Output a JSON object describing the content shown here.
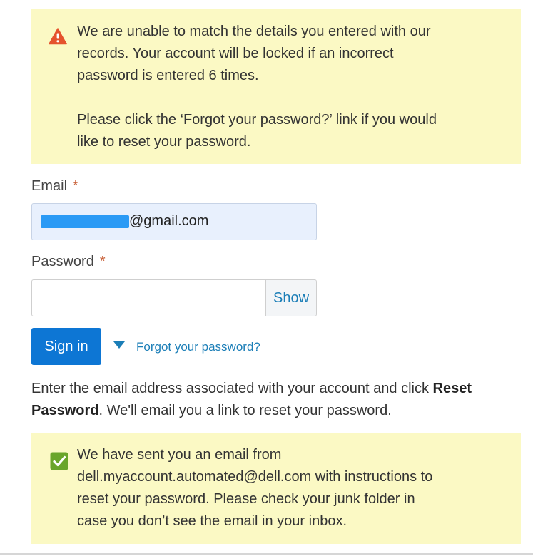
{
  "error_alert": {
    "icon": "warning-triangle-icon",
    "color": "#e5532d",
    "line1": "We are unable to match the details you entered with our",
    "line2": "records. Your account will be locked if an incorrect",
    "line3": "password is entered 6 times.",
    "line4": "Please click the ‘Forgot your password?’ link if you would",
    "line5": "like to reset your password."
  },
  "form": {
    "email_label": "Email",
    "required_marker": "*",
    "email_value_visible": "@gmail.com",
    "password_label": "Password",
    "password_value": "",
    "show_button": "Show",
    "signin_button": "Sign in",
    "forgot_link": "Forgot your password?"
  },
  "instructions": {
    "before": "Enter the email address associated with your account and click ",
    "bold": "Reset Password",
    "after": ". We'll email you a link to reset your password."
  },
  "success_alert": {
    "icon": "check-box-icon",
    "color": "#6aa52b",
    "line1": "We have sent you an email from",
    "line2": "dell.myaccount.automated@dell.com with instructions to",
    "line3": "reset your password. Please check your junk folder in",
    "line4": "case you don’t see the email in your inbox."
  },
  "colors": {
    "alert_bg": "#fbf9c4",
    "primary": "#0d76d4",
    "link": "#1b7eb7",
    "required": "#c9623a",
    "autofill_bg": "#e8f0fd"
  }
}
